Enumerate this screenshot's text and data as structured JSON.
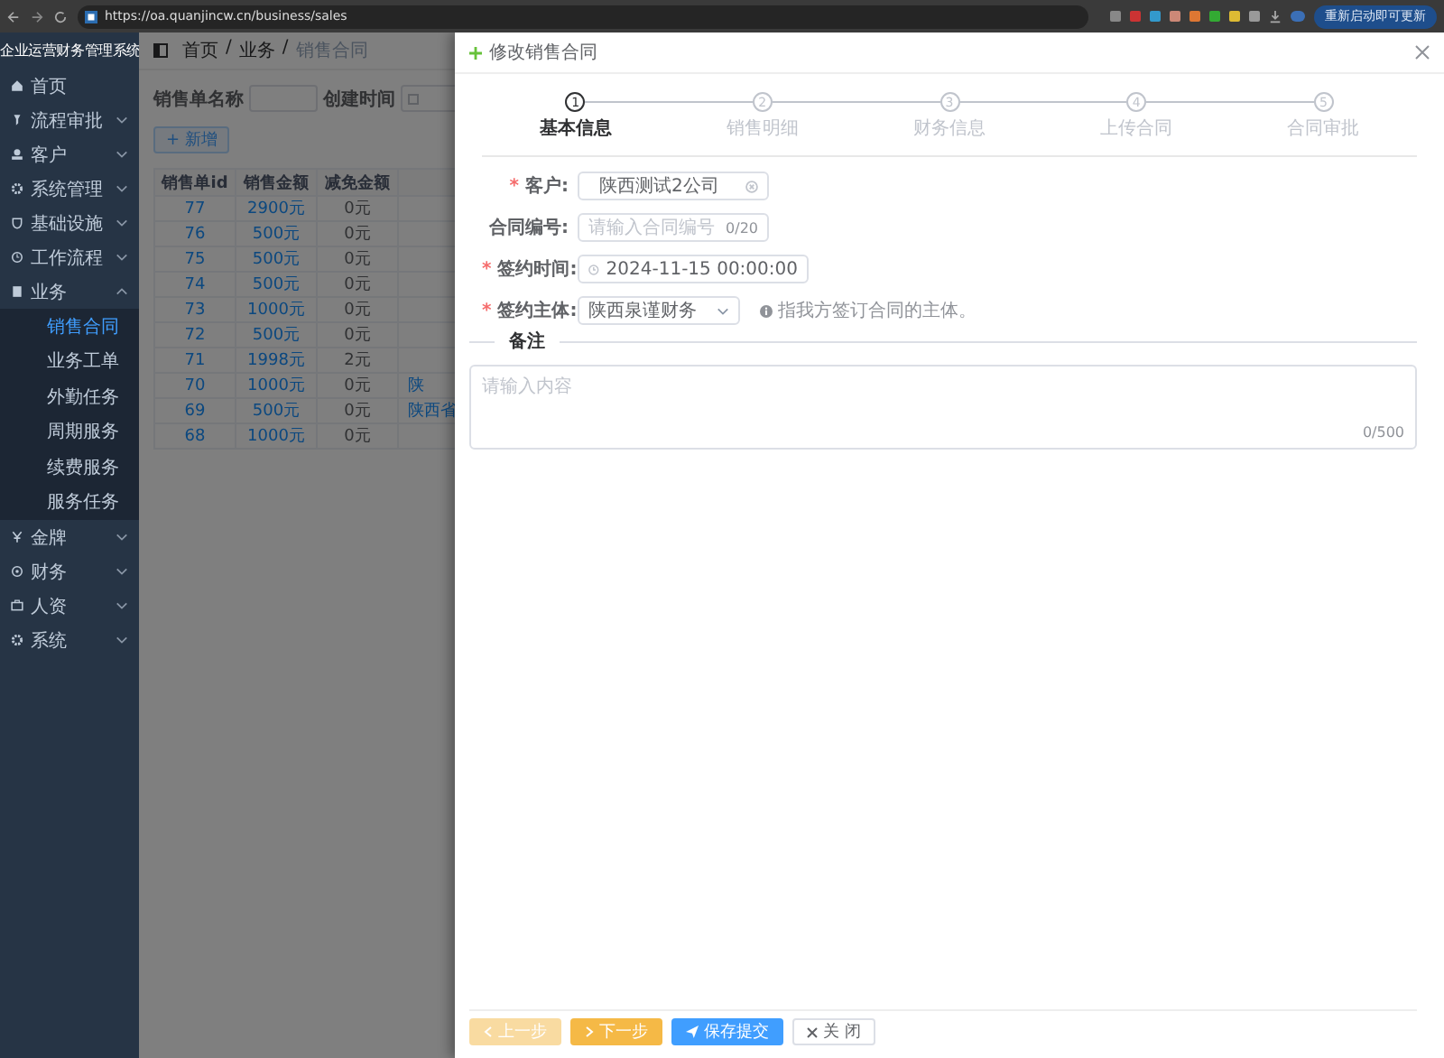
{
  "browser": {
    "url": "https://oa.quanjincw.cn/business/sales",
    "update_button": "重新启动即可更新"
  },
  "sidebar": {
    "title": "企业运营财务管理系统",
    "items": [
      {
        "label": "首页"
      },
      {
        "label": "流程审批",
        "expanded": false
      },
      {
        "label": "客户",
        "expanded": false
      },
      {
        "label": "系统管理",
        "expanded": false
      },
      {
        "label": "基础设施",
        "expanded": false
      },
      {
        "label": "工作流程",
        "expanded": false
      },
      {
        "label": "业务",
        "expanded": true,
        "children": [
          {
            "label": "销售合同",
            "selected": true
          },
          {
            "label": "业务工单",
            "selected": false
          },
          {
            "label": "外勤任务",
            "selected": false
          },
          {
            "label": "周期服务",
            "selected": false
          },
          {
            "label": "续费服务",
            "selected": false
          },
          {
            "label": "服务任务",
            "selected": false
          }
        ]
      },
      {
        "label": "金牌",
        "expanded": false
      },
      {
        "label": "财务",
        "expanded": false
      },
      {
        "label": "人资",
        "expanded": false
      },
      {
        "label": "系统",
        "expanded": false
      }
    ]
  },
  "breadcrumb": [
    "首页",
    "业务",
    "销售合同"
  ],
  "breadcrumb_separator": "/",
  "filters": [
    {
      "label": "销售单名称",
      "kind": "text"
    },
    {
      "label": "创建时间",
      "kind": "date"
    }
  ],
  "add_button": "+ 新增",
  "table": {
    "columns": [
      "销售单id",
      "销售金额",
      "减免金额"
    ],
    "rows": [
      {
        "id": "77",
        "amount": "2900元",
        "discount": "0元"
      },
      {
        "id": "76",
        "amount": "500元",
        "discount": "0元"
      },
      {
        "id": "75",
        "amount": "500元",
        "discount": "0元"
      },
      {
        "id": "74",
        "amount": "500元",
        "discount": "0元"
      },
      {
        "id": "73",
        "amount": "1000元",
        "discount": "0元"
      },
      {
        "id": "72",
        "amount": "500元",
        "discount": "0元"
      },
      {
        "id": "71",
        "amount": "1998元",
        "discount": "2元"
      },
      {
        "id": "70",
        "amount": "1000元",
        "discount": "0元",
        "column_4": "陕"
      },
      {
        "id": "69",
        "amount": "500元",
        "discount": "0元",
        "column_4": "陕西省"
      },
      {
        "id": "68",
        "amount": "1000元",
        "discount": "0元"
      }
    ]
  },
  "drawer": {
    "title": "修改销售合同",
    "required_mark": "*",
    "steps": [
      {
        "number": "1",
        "label": "基本信息",
        "selected": true
      },
      {
        "number": "2",
        "label": "销售明细",
        "selected": false
      },
      {
        "number": "3",
        "label": "财务信息",
        "selected": false
      },
      {
        "number": "4",
        "label": "上传合同",
        "selected": false
      },
      {
        "number": "5",
        "label": "合同审批",
        "selected": false
      }
    ],
    "fields": [
      {
        "kind": "select-clear",
        "label": "客户:",
        "required": true,
        "value": "陕西测试2公司"
      },
      {
        "kind": "text-counter",
        "label": "合同编号:",
        "required": false,
        "placeholder": "请输入合同编号",
        "counter": "0/20"
      },
      {
        "kind": "datetime",
        "label": "签约时间:",
        "required": true,
        "value": "2024-11-15 00:00:00"
      },
      {
        "kind": "select",
        "label": "签约主体:",
        "required": true,
        "value": "陕西泉谨财务",
        "hint": "指我方签订合同的主体。"
      }
    ],
    "remarks": {
      "label": "备注",
      "placeholder": "请输入内容",
      "counter": "0/500"
    },
    "buttons": [
      {
        "kind": "prev",
        "label": "上一步",
        "disabled": true
      },
      {
        "kind": "next",
        "label": "下一步",
        "disabled": false
      },
      {
        "kind": "submit",
        "label": "保存提交",
        "disabled": false
      },
      {
        "kind": "close",
        "label": "关 闭",
        "disabled": false
      }
    ]
  }
}
